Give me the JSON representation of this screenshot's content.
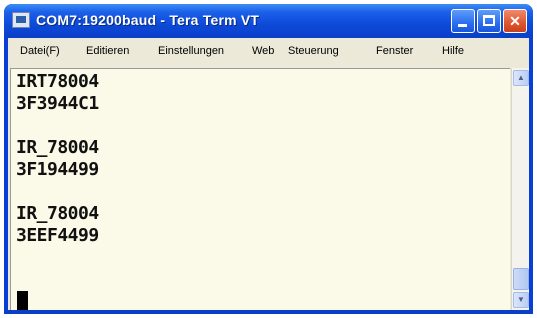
{
  "window": {
    "title": "COM7:19200baud - Tera Term VT",
    "icon": "teraterm-app-icon",
    "buttons": {
      "minimize_icon": "minimize-icon",
      "maximize_icon": "maximize-icon",
      "close_icon": "close-icon",
      "close_glyph": "✕"
    }
  },
  "menu": {
    "items": [
      "Datei(F)",
      "Editieren",
      "Einstellungen",
      "Web",
      "Steuerung",
      "Fenster",
      "Hilfe"
    ]
  },
  "terminal": {
    "lines": [
      "IRT78004",
      "3F3944C1",
      "",
      "IR_78004",
      "3F194499",
      "",
      "IR_78004",
      "3EEF4499"
    ]
  },
  "scrollbar": {
    "up_glyph": "▲",
    "down_glyph": "▼"
  },
  "colors": {
    "titlebar": "#0d4ad8",
    "terminal_bg": "#fbfae8",
    "text": "#111111",
    "close_button": "#e15a30"
  }
}
